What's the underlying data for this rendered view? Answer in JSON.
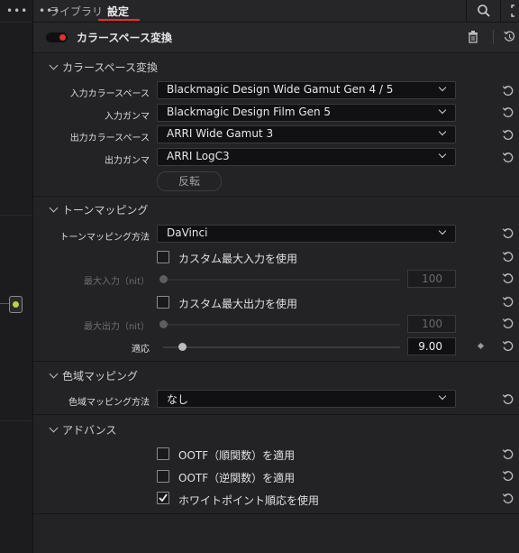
{
  "tabs": {
    "library": "ライブラリ",
    "settings": "設定"
  },
  "effect": {
    "title": "カラースペース変換",
    "enabled": true
  },
  "colors": {
    "accent_red": "#e2312e",
    "node_green": "#b7d34a"
  },
  "sections": {
    "colorspace": {
      "title": "カラースペース変換",
      "rows": [
        {
          "label": "入力カラースペース",
          "value": "Blackmagic Design Wide Gamut Gen 4 / 5"
        },
        {
          "label": "入力ガンマ",
          "value": "Blackmagic Design Film Gen 5"
        },
        {
          "label": "出力カラースペース",
          "value": "ARRI Wide Gamut 3"
        },
        {
          "label": "出力ガンマ",
          "value": "ARRI LogC3"
        }
      ],
      "invert_label": "反転"
    },
    "tone": {
      "title": "トーンマッピング",
      "method_label": "トーンマッピング方法",
      "method_value": "DaVinci",
      "custom_max_in_label": "カスタム最大入力を使用",
      "max_in_label": "最大入力（nit）",
      "max_in_value": "100",
      "custom_max_out_label": "カスタム最大出力を使用",
      "max_out_label": "最大出力（nit）",
      "max_out_value": "100",
      "adapt_label": "適応",
      "adapt_value": "9.00",
      "adapt_fraction": 0.08
    },
    "gamut": {
      "title": "色域マッピング",
      "method_label": "色域マッピング方法",
      "method_value": "なし"
    },
    "advanced": {
      "title": "アドバンス",
      "items": [
        {
          "label": "OOTF（順関数）を適用",
          "checked": false
        },
        {
          "label": "OOTF（逆関数）を適用",
          "checked": false
        },
        {
          "label": "ホワイトポイント順応を使用",
          "checked": true
        }
      ]
    }
  }
}
